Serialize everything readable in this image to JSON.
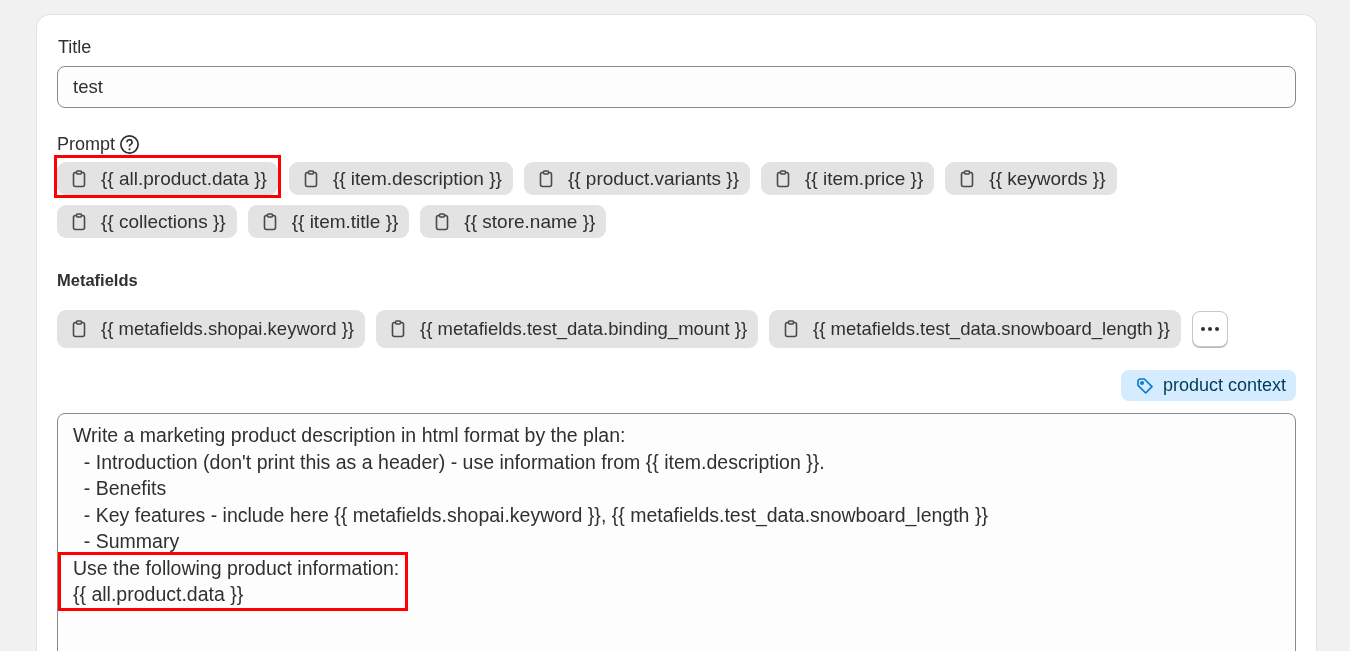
{
  "title_field": {
    "label": "Title",
    "value": "test"
  },
  "prompt": {
    "label": "Prompt",
    "variables": [
      {
        "text": "{{ all.product.data }}",
        "highlighted": true
      },
      {
        "text": "{{ item.description }}",
        "highlighted": false
      },
      {
        "text": "{{ product.variants }}",
        "highlighted": false
      },
      {
        "text": "{{ item.price }}",
        "highlighted": false
      },
      {
        "text": "{{ keywords }}",
        "highlighted": false
      },
      {
        "text": "{{ collections }}",
        "highlighted": false
      },
      {
        "text": "{{ item.title }}",
        "highlighted": false
      },
      {
        "text": "{{ store.name }}",
        "highlighted": false
      }
    ]
  },
  "metafields": {
    "heading": "Metafields",
    "variables": [
      {
        "text": "{{ metafields.shopai.keyword }}"
      },
      {
        "text": "{{ metafields.test_data.binding_mount }}"
      },
      {
        "text": "{{ metafields.test_data.snowboard_length }}"
      }
    ]
  },
  "context_tag": {
    "label": "product context"
  },
  "prompt_text": {
    "lines": [
      {
        "text": "Write a marketing product description in html format by the plan:",
        "highlighted": false
      },
      {
        "text": "  - Introduction (don't print this as a header) - use information from {{ item.description }}.",
        "highlighted": false
      },
      {
        "text": "  - Benefits",
        "highlighted": false
      },
      {
        "text": "  - Key features - include here {{ metafields.shopai.keyword }}, {{ metafields.test_data.snowboard_length }}",
        "highlighted": false
      },
      {
        "text": "  - Summary",
        "highlighted": false
      },
      {
        "text": "Use the following product information:",
        "highlighted": true
      },
      {
        "text": "{{ all.product.data }}",
        "highlighted": true
      }
    ]
  }
}
